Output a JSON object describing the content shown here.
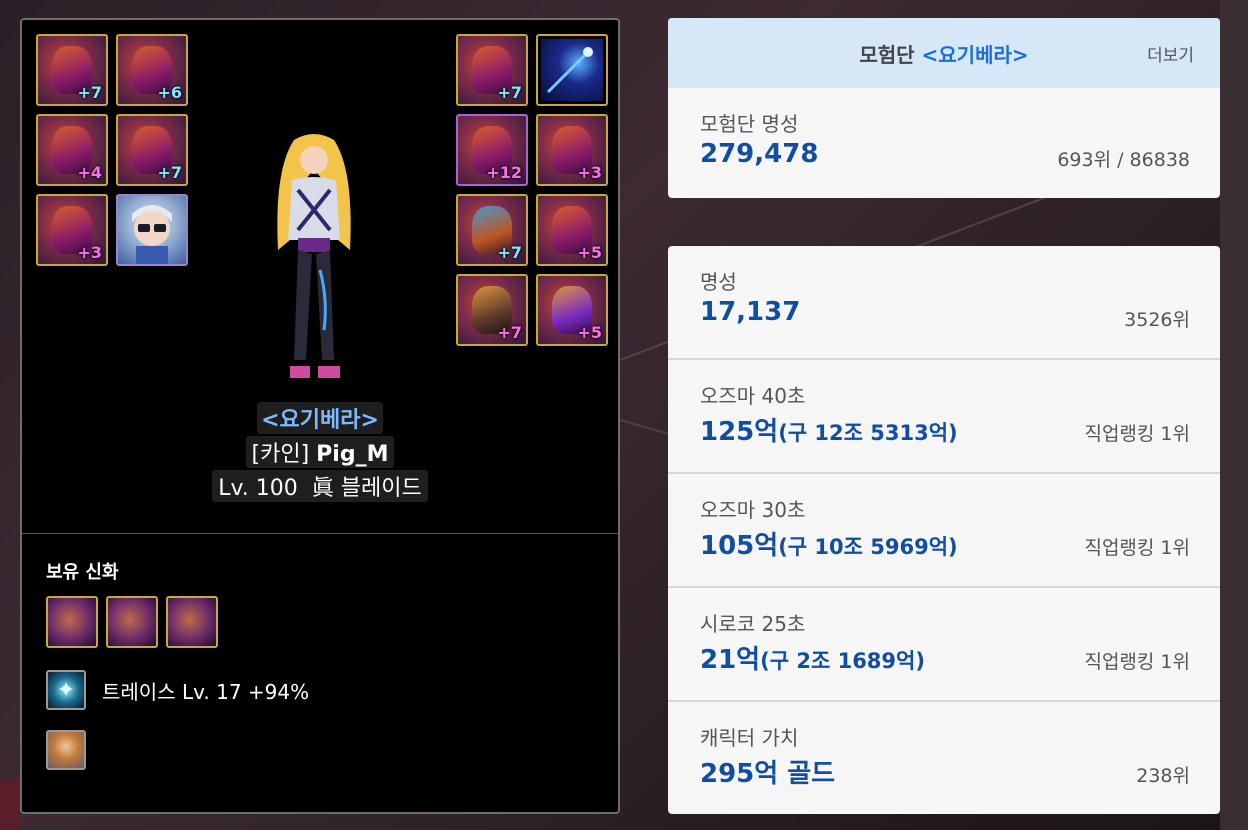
{
  "character": {
    "adventure_name": "<요기베라>",
    "server": "[카인]",
    "name": "Pig_M",
    "level_line": "Lv. 100",
    "job": "眞 블레이드",
    "left_slots": [
      "+7",
      "+6",
      "+4",
      "+7",
      "+3",
      ""
    ],
    "right_slots": [
      "+7",
      "",
      "+12",
      "+3",
      "+7",
      "+5",
      "+7",
      "+5"
    ]
  },
  "myth": {
    "title": "보유 신화",
    "trace_text": "트레이스 Lv. 17 +94%"
  },
  "adventure_card": {
    "title_prefix": "모험단",
    "title_name": "<요기베라>",
    "more": "더보기",
    "fame_label": "모험단 명성",
    "fame_value": "279,478",
    "fame_rank": "693위 / 86838"
  },
  "stats": [
    {
      "label": "명성",
      "value": "17,137",
      "sub": "",
      "right": "3526위"
    },
    {
      "label": "오즈마 40초",
      "value": "125억",
      "sub": "(구 12조 5313억)",
      "right": "직업랭킹 1위"
    },
    {
      "label": "오즈마 30초",
      "value": "105억",
      "sub": "(구 10조 5969억)",
      "right": "직업랭킹 1위"
    },
    {
      "label": "시로코 25초",
      "value": "21억",
      "sub": "(구 2조 1689억)",
      "right": "직업랭킹 1위"
    },
    {
      "label": "캐릭터 가치",
      "value": "295억 골드",
      "sub": "",
      "right": "238위"
    }
  ]
}
